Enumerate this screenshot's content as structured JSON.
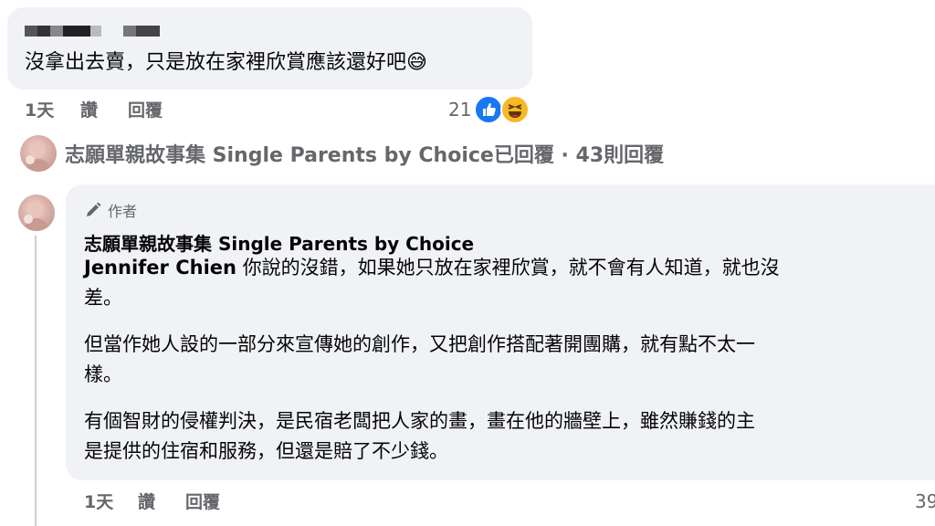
{
  "comment1": {
    "text": "沒拿出去賣，只是放在家裡欣賞應該還好吧",
    "emoji": "😅",
    "time": "1天",
    "like_label": "讚",
    "reply_label": "回覆",
    "reaction_count": "21"
  },
  "replies_summary": {
    "text": "志願單親故事集 Single Parents by Choice已回覆 · 43則回覆"
  },
  "reply": {
    "author_badge": "作者",
    "author_name": "志願單親故事集 Single Parents by Choice",
    "mention": "Jennifer Chien",
    "para1_rest": " 你說的沒錯，如果她只放在家裡欣賞，就不會有人知道，就也沒",
    "para1_line2": "差。",
    "para2_line1": "但當作她人設的一部分來宣傳她的創作，又把創作搭配著開團購，就有點不太一",
    "para2_line2": "樣。",
    "para3_line1": "有個智財的侵權判決，是民宿老闆把人家的畫，畫在他的牆壁上，雖然賺錢的主",
    "para3_line2": "是提供的住宿和服務，但還是賠了不少錢。",
    "time": "1天",
    "like_label": "讚",
    "reply_label": "回覆",
    "reaction_count_partial": "39"
  },
  "colors": {
    "bubble": "#f0f2f5",
    "secondary_text": "#65676b",
    "like_blue": "#1877f2",
    "haha_yellow": "#f7b928"
  },
  "icons": [
    "like-icon",
    "haha-icon",
    "pencil-icon",
    "avatar"
  ]
}
